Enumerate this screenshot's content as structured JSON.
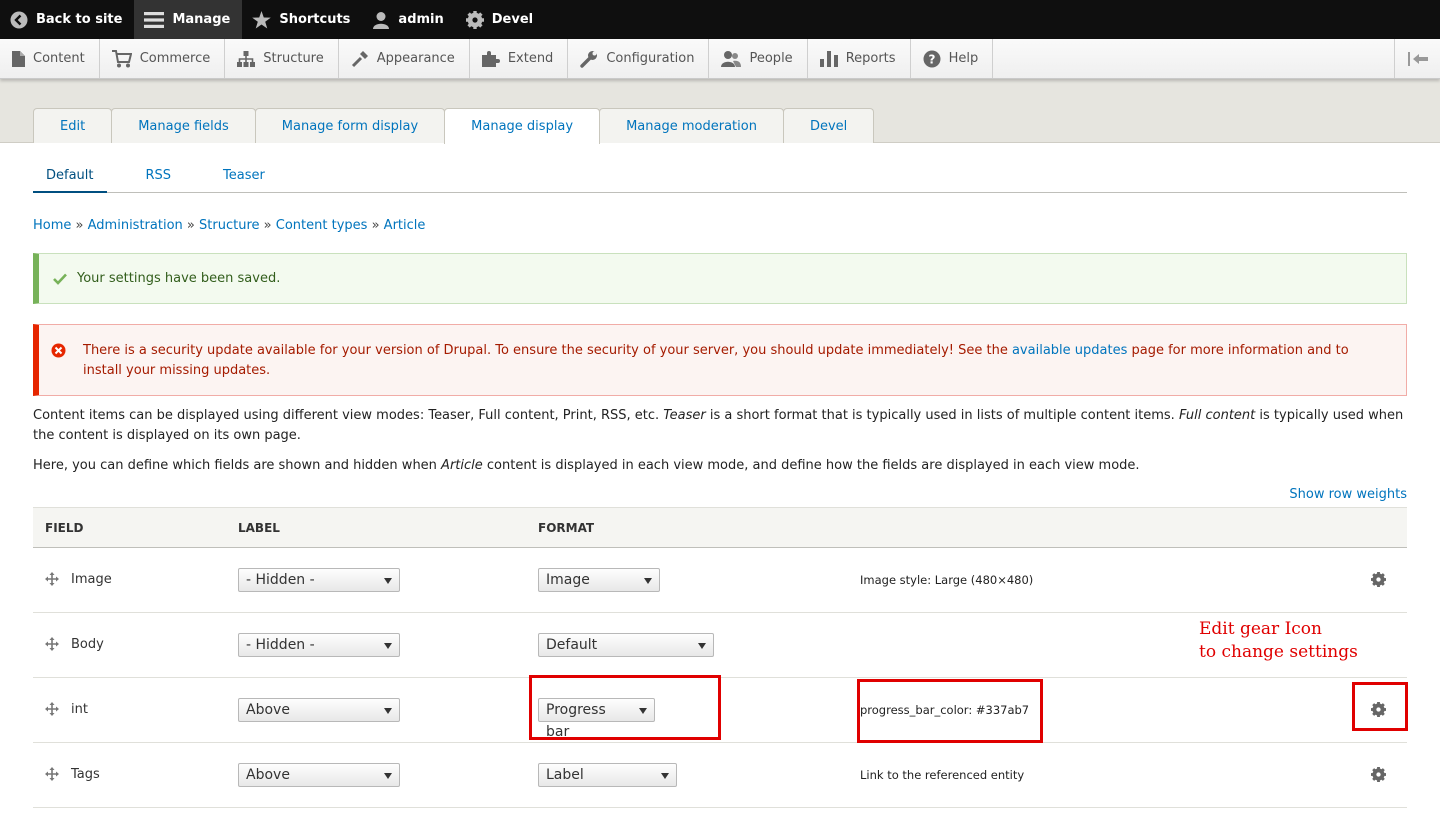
{
  "toolbar": {
    "back_to_site": "Back to site",
    "manage": "Manage",
    "shortcuts": "Shortcuts",
    "user": "admin",
    "devel": "Devel"
  },
  "admin_menu": {
    "items": [
      "Content",
      "Commerce",
      "Structure",
      "Appearance",
      "Extend",
      "Configuration",
      "People",
      "Reports",
      "Help"
    ]
  },
  "primary_tabs": [
    "Edit",
    "Manage fields",
    "Manage form display",
    "Manage display",
    "Manage moderation",
    "Devel"
  ],
  "secondary_tabs": [
    "Default",
    "RSS",
    "Teaser"
  ],
  "breadcrumb": [
    "Home",
    "Administration",
    "Structure",
    "Content types",
    "Article"
  ],
  "breadcrumb_separator": "»",
  "status_message": "Your settings have been saved.",
  "error_message": {
    "before_link": "There is a security update available for your version of Drupal. To ensure the security of your server, you should update immediately! See the ",
    "link": "available updates",
    "after_link": " page for more information and to install your missing updates."
  },
  "description": {
    "p1_a": "Content items can be displayed using different view modes: Teaser, Full content, Print, RSS, etc. ",
    "p1_em1": "Teaser",
    "p1_b": " is a short format that is typically used in lists of multiple content items. ",
    "p1_em2": "Full content",
    "p1_c": " is typically used when the content is displayed on its own page.",
    "p2_a": "Here, you can define which fields are shown and hidden when ",
    "p2_em": "Article",
    "p2_b": " content is displayed in each view mode, and define how the fields are displayed in each view mode."
  },
  "show_row_weights": "Show row weights",
  "table": {
    "headers": {
      "field": "FIELD",
      "label": "LABEL",
      "format": "FORMAT"
    },
    "rows": [
      {
        "field": "Image",
        "label": "- Hidden -",
        "format": "Image",
        "summary": "Image style: Large (480×480)"
      },
      {
        "field": "Body",
        "label": "- Hidden -",
        "format": "Default",
        "summary": ""
      },
      {
        "field": "int",
        "label": "Above",
        "format": "Progress bar",
        "summary": "progress_bar_color: #337ab7"
      },
      {
        "field": "Tags",
        "label": "Above",
        "format": "Label",
        "summary": "Link to the referenced entity"
      }
    ]
  },
  "annotation": {
    "line1": "Edit gear Icon",
    "line2": "to change settings",
    "color": "#e00000"
  },
  "colors": {
    "link": "#0074bd",
    "toolbar_bg": "#0f0f0f",
    "success_border": "#77b259",
    "error_border": "#e62600"
  }
}
